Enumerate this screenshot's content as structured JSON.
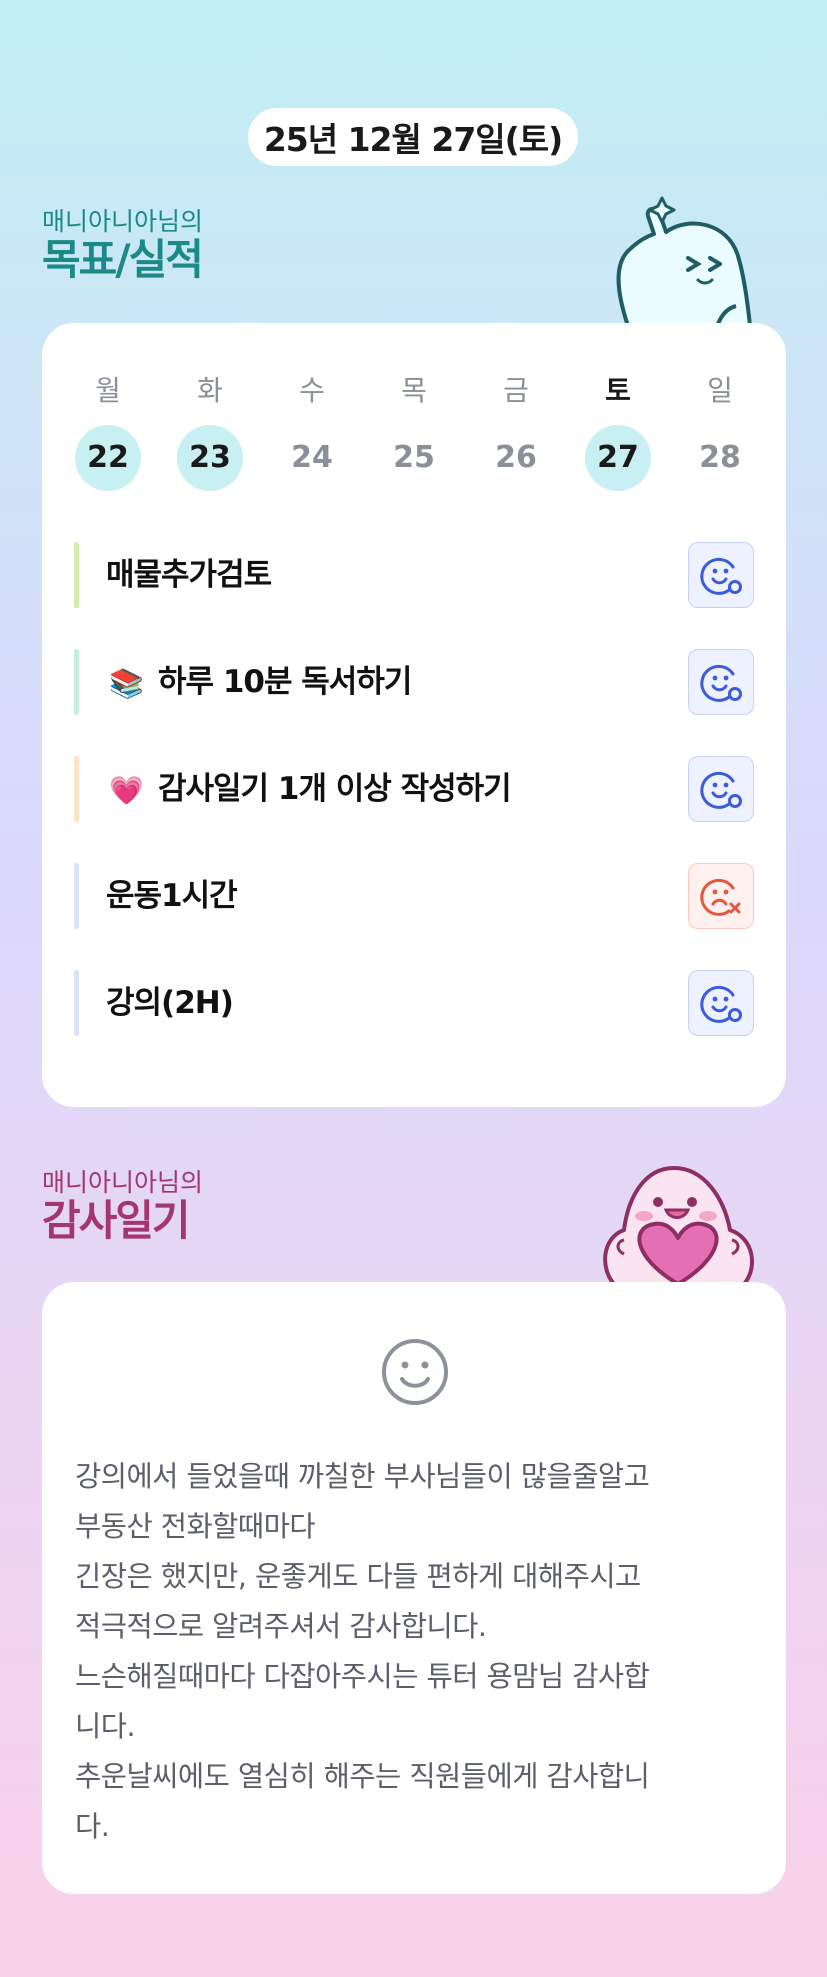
{
  "date_label": "25년 12월 27일(토)",
  "goals_section": {
    "subtitle": "매니아니아님의",
    "title": "목표/실적"
  },
  "week": [
    {
      "dow": "월",
      "num": "22",
      "state": "done"
    },
    {
      "dow": "화",
      "num": "23",
      "state": "done"
    },
    {
      "dow": "수",
      "num": "24",
      "state": "none"
    },
    {
      "dow": "목",
      "num": "25",
      "state": "none"
    },
    {
      "dow": "금",
      "num": "26",
      "state": "none"
    },
    {
      "dow": "토",
      "num": "27",
      "state": "today"
    },
    {
      "dow": "일",
      "num": "28",
      "state": "none"
    }
  ],
  "goals": [
    {
      "label": "매물추가검토",
      "emoji": "",
      "bar_color": "#d4ecad",
      "status": "success"
    },
    {
      "label": "하루 10분 독서하기",
      "emoji": "📚",
      "bar_color": "#c7efe0",
      "status": "success"
    },
    {
      "label": "감사일기 1개 이상 작성하기",
      "emoji": "💗",
      "bar_color": "#fde2c7",
      "status": "success"
    },
    {
      "label": "운동1시간",
      "emoji": "",
      "bar_color": "#d9e4fb",
      "status": "fail"
    },
    {
      "label": "강의(2H)",
      "emoji": "",
      "bar_color": "#d9e4fb",
      "status": "success"
    }
  ],
  "colors": {
    "success": "#3b5bdb",
    "fail": "#e8553f",
    "goals_heading": "#1b8a86",
    "diary_heading": "#a3356f"
  },
  "diary_section": {
    "subtitle": "매니아니아님의",
    "title": "감사일기",
    "lines": [
      "강의에서 들었을때 까칠한 부사님들이 많을줄알고",
      "부동산 전화할때마다",
      "긴장은 했지만, 운좋게도 다들 편하게 대해주시고",
      "적극적으로 알려주셔서 감사합니다.",
      "느슨해질때마다 다잡아주시는 튜터 용맘님 감사합",
      "니다.",
      "추운날씨에도 열심히 해주는 직원들에게 감사합니",
      "다."
    ]
  }
}
